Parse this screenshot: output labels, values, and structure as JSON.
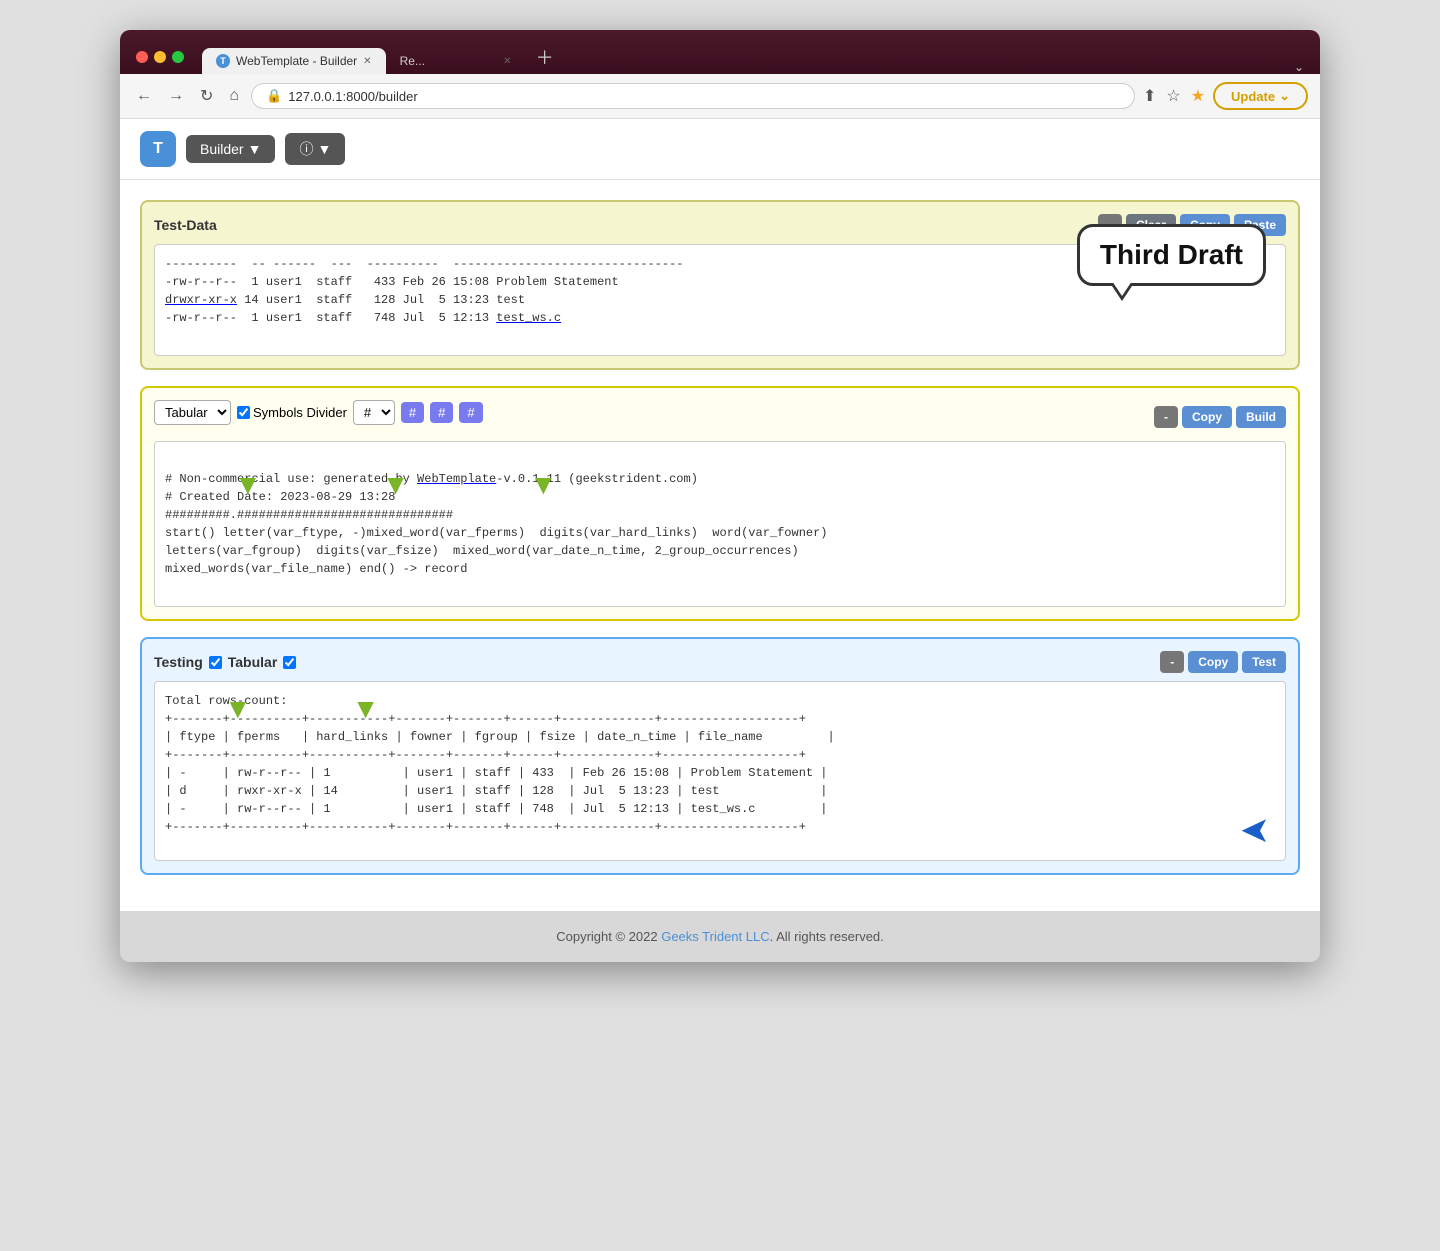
{
  "browser": {
    "tab_active_label": "WebTemplate - Builder",
    "tab_inactive_label": "Re...",
    "url": "127.0.0.1:8000/builder",
    "update_btn": "Update"
  },
  "app": {
    "logo_letter": "T",
    "builder_btn": "Builder",
    "info_btn": "ⓘ"
  },
  "testdata_panel": {
    "title": "Test-Data",
    "btn_minus": "-",
    "btn_clear": "Clear",
    "btn_copy": "Copy",
    "btn_paste": "Paste",
    "content": "---------- -- ------ --- ---------- --------------------------------\n-rw-r--r--  1 user1  staff   433 Feb 26 15:08 Problem Statement\ndrwxr-xr-x 14 user1  staff   128 Jul  5 13:23 test\n-rw-r--r--  1 user1  staff   748 Jul  5 12:13 test_ws.c"
  },
  "template_panel": {
    "select_option": "Tabular",
    "checkbox_label": "Symbols Divider",
    "hash1": "#",
    "hash2": "#",
    "hash3": "#",
    "btn_minus": "-",
    "btn_copy": "Copy",
    "btn_build": "Build",
    "content": "# Non-commercial use: generated by WebTemplate-v.0.1.11 (geekstrident.com)\n# Created Date: 2023-08-29 13:28\n#########.##############################\nstart() letter(var_ftype, -)mixed_word(var_fperms)  digits(var_hard_links)  word(var_fowner)\nletters(var_fgroup)  digits(var_fsize)  mixed_word(var_date_n_time, 2_group_occurrences)\nmixed_words(var_file_name) end() -> record"
  },
  "testing_panel": {
    "title": "Testing",
    "tabular_label": "Tabular",
    "btn_minus": "-",
    "btn_copy": "Copy",
    "btn_test": "Test",
    "content": "Total rows-count:\n+-------+----------+-----------+-------+-------+------+-------------+-------------------+\n| ftype | fperms   | hard_links | fowner | fgroup | fsize | date_n_time | file_name         |\n+-------+----------+-----------+-------+-------+------+-------------+-------------------+\n| -     | rw-r--r-- | 1          | user1 | staff | 433  | Feb 26 15:08 | Problem Statement |\n| d     | rwxr-xr-x | 14         | user1 | staff | 128  | Jul  5 13:23 | test              |\n| -     | rw-r--r-- | 1          | user1 | staff | 748  | Jul  5 12:13 | test_ws.c         |\n+-------+----------+-----------+-------+-------+------+-------------+-------------------+"
  },
  "callout": {
    "text": "Third Draft"
  },
  "footer": {
    "copyright": "Copyright © 2022 ",
    "link_text": "Geeks Trident LLC",
    "suffix": ". All rights reserved."
  }
}
